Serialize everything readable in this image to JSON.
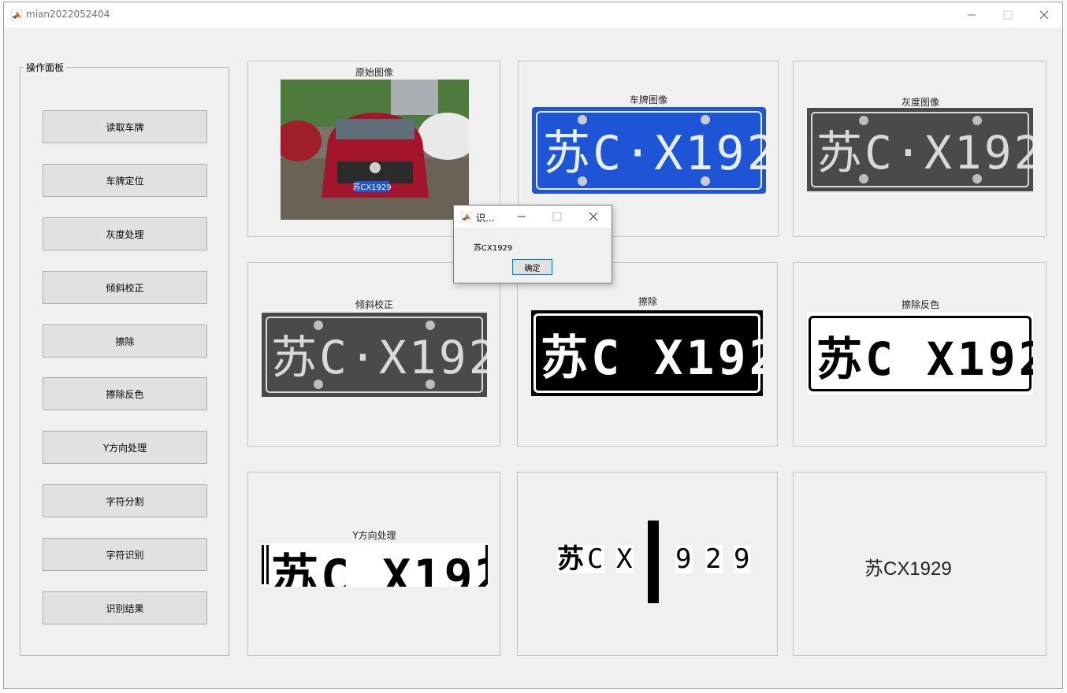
{
  "window": {
    "title": "mian2022052404"
  },
  "panel": {
    "legend": "操作面板",
    "buttons": [
      "读取车牌",
      "车牌定位",
      "灰度处理",
      "倾斜校正",
      "擦除",
      "擦除反色",
      "Y方向处理",
      "字符分割",
      "字符识别",
      "识别结果"
    ]
  },
  "axes": {
    "original": "原始图像",
    "plate": "车牌图像",
    "gray": "灰度图像",
    "tilt": "倾斜校正",
    "erase": "擦除",
    "erase_inv": "擦除反色",
    "y_dir": "Y方向处理"
  },
  "plate_text": {
    "prov": "苏",
    "city": "C",
    "dot": "·",
    "rest": "X1929"
  },
  "segments": [
    "苏",
    "C",
    "X",
    "",
    "9",
    "2",
    "9"
  ],
  "result_text": "苏CX1929",
  "dialog": {
    "title": "识...",
    "message": "苏CX1929",
    "ok_label": "确定"
  },
  "colors": {
    "plate_blue": "#1e55d6",
    "background": "#f0f0f0",
    "button": "#e1e1e1"
  }
}
